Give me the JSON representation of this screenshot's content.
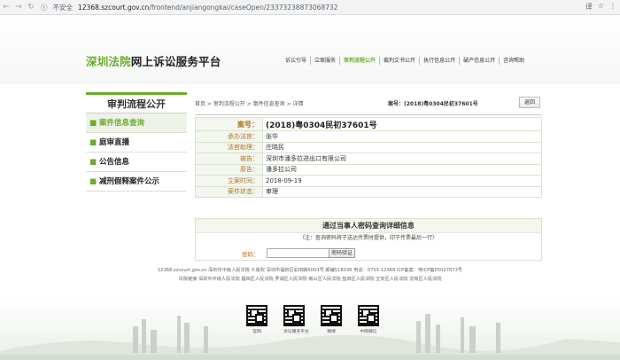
{
  "browser": {
    "security_label": "不安全",
    "url_host": "12368.szcourt.gov.cn",
    "url_path": "/frontend/anjiangongkai/caseOpen/23373238873068732"
  },
  "header": {
    "logo_part1": "深圳法院",
    "logo_part2": "网上诉讼服务平台",
    "nav": [
      "诉讼引导",
      "立案服务",
      "审判流程公开",
      "裁判文书公开",
      "执行信息公开",
      "破产信息公开",
      "咨询帮助"
    ],
    "active_nav_index": 2
  },
  "sidebar": {
    "title": "审判流程公开",
    "items": [
      {
        "label": "案件信息查询",
        "active": true
      },
      {
        "label": "庭审直播",
        "active": false
      },
      {
        "label": "公告信息",
        "active": false
      },
      {
        "label": "减刑假释案件公示",
        "active": false
      }
    ]
  },
  "breadcrumb": {
    "items": "首页 > 审判流程公开 > 案件信息查询 > 详情",
    "case_top": "案号：(2018)粤0304民初37601号",
    "back_label": "返回"
  },
  "case": {
    "rows": [
      {
        "label": "案号：",
        "value": "(2018)粤0304民初37601号"
      },
      {
        "label": "承办法官：",
        "value": "张华"
      },
      {
        "label": "法官助理：",
        "value": "庄晓民"
      },
      {
        "label": "被告：",
        "value": "深圳市潘多拉进出口有限公司"
      },
      {
        "label": "原告：",
        "value": "潘多拉公司"
      },
      {
        "label": "立案时间：",
        "value": "2018-09-19"
      },
      {
        "label": "案件状态：",
        "value": "审理"
      }
    ]
  },
  "password_query": {
    "title": "通过当事人密码查询详细信息",
    "note": "（注：查询密码将于送达传票时提供，印于传票最后一行）",
    "label": "密码：",
    "button": "密码验证"
  },
  "footer": {
    "line1": "12368.szcourt.gov.cn 深圳市中级人民法院 ©版权 深圳市福田区彩田路6003号 邮编518036 电话：0755-12368 ICP备案：粤ICP备05027873号",
    "line2": "法院链接 深圳市中级人民法院 福田区人民法院 罗湖区人民法院 南山区人民法院 盐田区人民法院 宝安区人民法院 龙岗区人民法院",
    "qr": [
      "官网",
      "诉讼服务平台",
      "微博",
      "中院微信"
    ]
  }
}
